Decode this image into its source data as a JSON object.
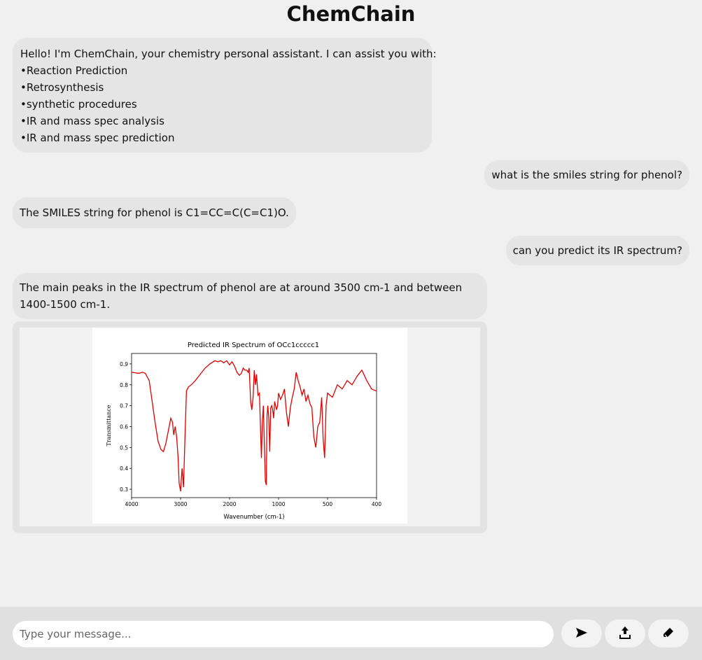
{
  "app": {
    "title": "ChemChain"
  },
  "messages": {
    "greeting": {
      "intro": "Hello! I'm ChemChain, your chemistry personal assistant. I can assist you with:",
      "items": [
        "•Reaction Prediction",
        "•Retrosynthesis",
        "•synthetic procedures",
        "•IR and mass spec analysis",
        "•IR and mass spec prediction"
      ]
    },
    "user_1": "what is the smiles string for phenol?",
    "bot_1": "The SMILES string for phenol is C1=CC=C(C=C1)O.",
    "user_2": "can you predict its IR spectrum?",
    "bot_2": "The main peaks in the IR spectrum of phenol are at around 3500 cm-1 and between 1400-1500 cm-1."
  },
  "composer": {
    "placeholder": "Type your message...",
    "send_icon": "send-icon",
    "upload_icon": "upload-icon",
    "clear_icon": "eraser-icon"
  },
  "colors": {
    "spectrum_line": "#e00000",
    "bubble": "#e5e5e5",
    "background": "#f0f0f0"
  },
  "chart_data": {
    "type": "line",
    "title": "Predicted IR Spectrum of OCc1ccccc1",
    "xlabel": "Wavenumber (cm-1)",
    "ylabel": "Transmittance",
    "xlim": [
      4000,
      400
    ],
    "ylim": [
      0.26,
      0.95
    ],
    "x_ticks": [
      "4000",
      "3000",
      "2000",
      "1000",
      "500",
      "400"
    ],
    "y_ticks": [
      "0.3",
      "0.4",
      "0.5",
      "0.6",
      "0.7",
      "0.8",
      "0.9"
    ],
    "series": [
      {
        "color": "#e00000",
        "points": [
          [
            4000,
            0.86
          ],
          [
            3850,
            0.855
          ],
          [
            3780,
            0.86
          ],
          [
            3720,
            0.855
          ],
          [
            3640,
            0.82
          ],
          [
            3580,
            0.72
          ],
          [
            3520,
            0.62
          ],
          [
            3460,
            0.53
          ],
          [
            3400,
            0.49
          ],
          [
            3350,
            0.48
          ],
          [
            3300,
            0.52
          ],
          [
            3250,
            0.58
          ],
          [
            3200,
            0.64
          ],
          [
            3165,
            0.62
          ],
          [
            3140,
            0.56
          ],
          [
            3110,
            0.6
          ],
          [
            3080,
            0.55
          ],
          [
            3050,
            0.45
          ],
          [
            3030,
            0.33
          ],
          [
            3000,
            0.29
          ],
          [
            2970,
            0.4
          ],
          [
            2940,
            0.31
          ],
          [
            2910,
            0.55
          ],
          [
            2880,
            0.77
          ],
          [
            2840,
            0.79
          ],
          [
            2780,
            0.8
          ],
          [
            2700,
            0.82
          ],
          [
            2600,
            0.85
          ],
          [
            2500,
            0.88
          ],
          [
            2400,
            0.9
          ],
          [
            2300,
            0.915
          ],
          [
            2240,
            0.91
          ],
          [
            2180,
            0.915
          ],
          [
            2120,
            0.905
          ],
          [
            2060,
            0.915
          ],
          [
            2000,
            0.895
          ],
          [
            1950,
            0.91
          ],
          [
            1900,
            0.89
          ],
          [
            1850,
            0.86
          ],
          [
            1800,
            0.845
          ],
          [
            1760,
            0.855
          ],
          [
            1720,
            0.88
          ],
          [
            1690,
            0.87
          ],
          [
            1650,
            0.87
          ],
          [
            1620,
            0.86
          ],
          [
            1600,
            0.88
          ],
          [
            1570,
            0.72
          ],
          [
            1545,
            0.68
          ],
          [
            1520,
            0.74
          ],
          [
            1495,
            0.87
          ],
          [
            1470,
            0.8
          ],
          [
            1450,
            0.85
          ],
          [
            1420,
            0.75
          ],
          [
            1390,
            0.76
          ],
          [
            1370,
            0.6
          ],
          [
            1350,
            0.45
          ],
          [
            1330,
            0.62
          ],
          [
            1310,
            0.7
          ],
          [
            1290,
            0.52
          ],
          [
            1270,
            0.34
          ],
          [
            1250,
            0.32
          ],
          [
            1235,
            0.65
          ],
          [
            1220,
            0.7
          ],
          [
            1200,
            0.64
          ],
          [
            1180,
            0.48
          ],
          [
            1160,
            0.69
          ],
          [
            1140,
            0.7
          ],
          [
            1120,
            0.68
          ],
          [
            1100,
            0.64
          ],
          [
            1080,
            0.72
          ],
          [
            1060,
            0.7
          ],
          [
            1040,
            0.68
          ],
          [
            1020,
            0.7
          ],
          [
            1000,
            0.76
          ],
          [
            980,
            0.73
          ],
          [
            960,
            0.75
          ],
          [
            940,
            0.78
          ],
          [
            920,
            0.67
          ],
          [
            900,
            0.6
          ],
          [
            880,
            0.69
          ],
          [
            860,
            0.74
          ],
          [
            840,
            0.78
          ],
          [
            820,
            0.86
          ],
          [
            800,
            0.82
          ],
          [
            780,
            0.79
          ],
          [
            760,
            0.75
          ],
          [
            740,
            0.78
          ],
          [
            720,
            0.72
          ],
          [
            700,
            0.75
          ],
          [
            680,
            0.71
          ],
          [
            660,
            0.69
          ],
          [
            640,
            0.55
          ],
          [
            620,
            0.5
          ],
          [
            600,
            0.6
          ],
          [
            580,
            0.62
          ],
          [
            560,
            0.74
          ],
          [
            545,
            0.54
          ],
          [
            530,
            0.45
          ],
          [
            515,
            0.7
          ],
          [
            500,
            0.76
          ],
          [
            490,
            0.74
          ],
          [
            480,
            0.8
          ],
          [
            470,
            0.78
          ],
          [
            460,
            0.82
          ],
          [
            450,
            0.8
          ],
          [
            440,
            0.84
          ],
          [
            430,
            0.87
          ],
          [
            420,
            0.82
          ],
          [
            410,
            0.78
          ],
          [
            400,
            0.77
          ]
        ]
      }
    ]
  }
}
